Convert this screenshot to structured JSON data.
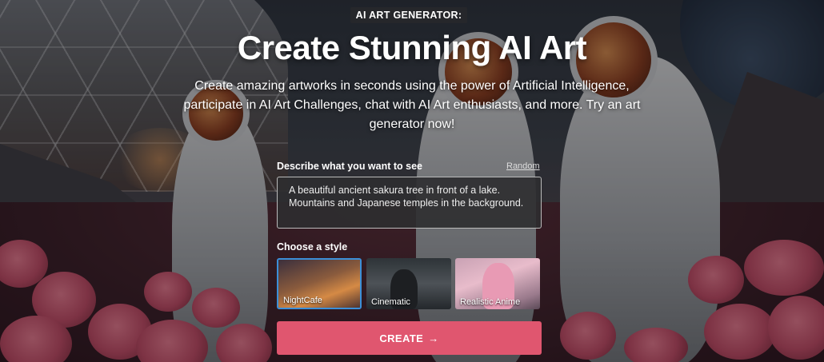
{
  "hero": {
    "badge": "AI ART GENERATOR:",
    "title": "Create Stunning AI Art",
    "subtitle": "Create amazing artworks in seconds using the power of Artificial Intelligence, participate in AI Art Challenges, chat with AI Art enthusiasts, and more. Try an art generator now!"
  },
  "form": {
    "prompt_label": "Describe what you want to see",
    "random_label": "Random",
    "prompt_value": "A beautiful ancient sakura tree in front of a lake. Mountains and Japanese temples in the background.",
    "style_label": "Choose a style",
    "styles": [
      {
        "label": "NightCafe",
        "selected": true
      },
      {
        "label": "Cinematic",
        "selected": false
      },
      {
        "label": "Realistic Anime",
        "selected": false
      }
    ],
    "create_label": "CREATE",
    "create_icon": "→"
  },
  "colors": {
    "accent": "#e0566f",
    "selected_border": "#3b8fd8"
  }
}
